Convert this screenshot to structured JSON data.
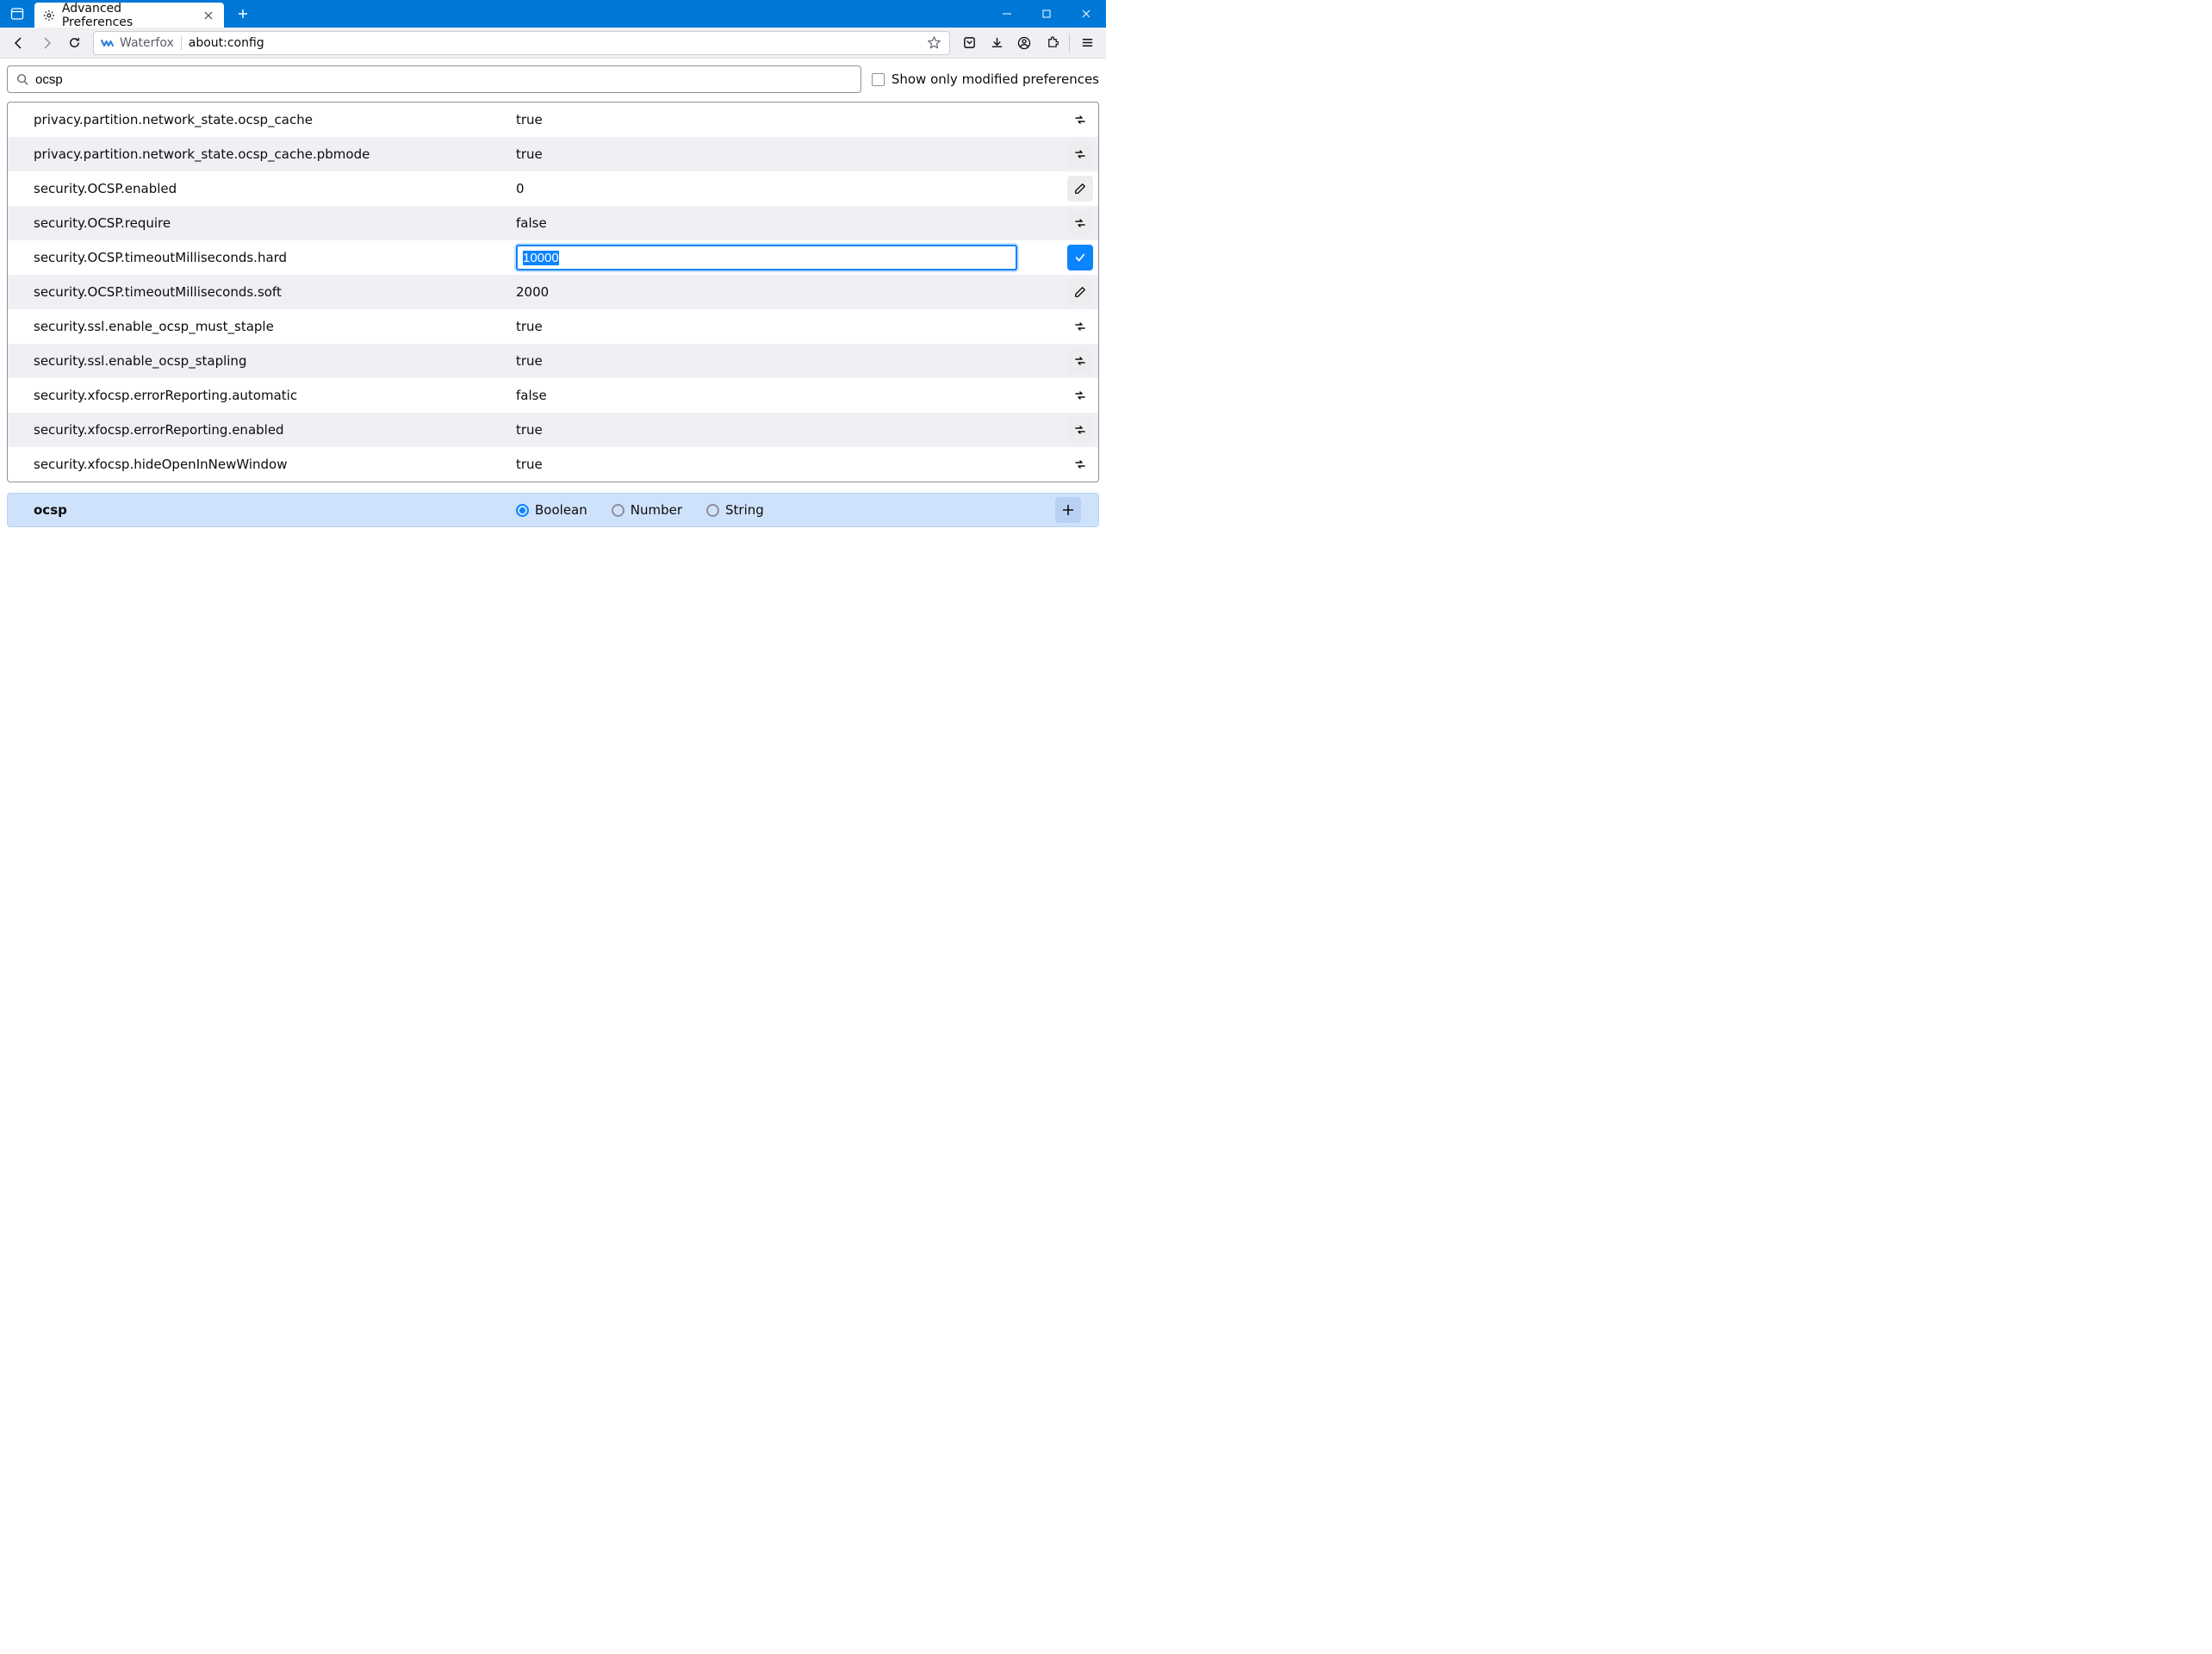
{
  "window": {
    "tab_title": "Advanced Preferences",
    "brand_name": "Waterfox",
    "url": "about:config"
  },
  "search": {
    "value": "ocsp",
    "show_modified_label": "Show only modified preferences",
    "show_modified_checked": false
  },
  "prefs": [
    {
      "name": "privacy.partition.network_state.ocsp_cache",
      "value": "true",
      "action": "toggle"
    },
    {
      "name": "privacy.partition.network_state.ocsp_cache.pbmode",
      "value": "true",
      "action": "toggle"
    },
    {
      "name": "security.OCSP.enabled",
      "value": "0",
      "action": "edit"
    },
    {
      "name": "security.OCSP.require",
      "value": "false",
      "action": "toggle"
    },
    {
      "name": "security.OCSP.timeoutMilliseconds.hard",
      "value": "10000",
      "action": "save",
      "editing": true
    },
    {
      "name": "security.OCSP.timeoutMilliseconds.soft",
      "value": "2000",
      "action": "edit"
    },
    {
      "name": "security.ssl.enable_ocsp_must_staple",
      "value": "true",
      "action": "toggle"
    },
    {
      "name": "security.ssl.enable_ocsp_stapling",
      "value": "true",
      "action": "toggle"
    },
    {
      "name": "security.xfocsp.errorReporting.automatic",
      "value": "false",
      "action": "toggle"
    },
    {
      "name": "security.xfocsp.errorReporting.enabled",
      "value": "true",
      "action": "toggle"
    },
    {
      "name": "security.xfocsp.hideOpenInNewWindow",
      "value": "true",
      "action": "toggle"
    }
  ],
  "addrow": {
    "name": "ocsp",
    "type_selected": "Boolean",
    "types": {
      "boolean": "Boolean",
      "number": "Number",
      "string": "String"
    }
  }
}
